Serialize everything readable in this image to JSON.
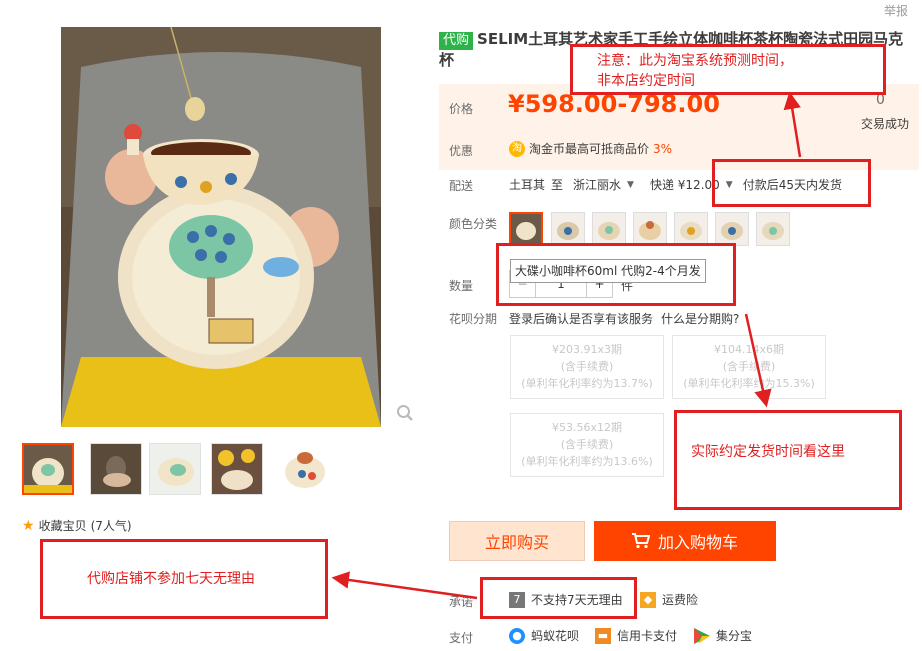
{
  "header": {
    "report_link": "举报"
  },
  "product": {
    "tag": "代购",
    "title": "SELIM土耳其艺术家手工手绘立体咖啡杯茶杯陶瓷法式田园马克杯"
  },
  "price": {
    "label": "价格",
    "value": "¥598.00-798.00",
    "sold_count": "0",
    "sold_label": "交易成功"
  },
  "promo": {
    "label": "优惠",
    "coin_icon": "淘",
    "text": "淘金币最高可抵商品价",
    "percent": "3%"
  },
  "delivery": {
    "label": "配送",
    "origin": "土耳其",
    "to_word": "至",
    "destination": "浙江丽水",
    "shipping": "快递 ¥12.00",
    "ship_time": "付款后45天内发货"
  },
  "color": {
    "label": "颜色分类",
    "tooltip": "大碟小咖啡杯60ml 代购2-4个月发",
    "option_count": 7
  },
  "quantity": {
    "label": "数量",
    "value": "1",
    "minus": "−",
    "plus": "+",
    "unit": "件"
  },
  "huabei": {
    "label": "花呗分期",
    "text": "登录后确认是否享有该服务",
    "link": "什么是分期购?",
    "stages": [
      {
        "amount": "¥203.91x3期",
        "fee": "(含手续费)",
        "rate": "(单利年化利率约为13.7%)"
      },
      {
        "amount": "¥104.14x6期",
        "fee": "(含手续费)",
        "rate": "(单利年化利率约为15.3%)"
      },
      {
        "amount": "¥53.56x12期",
        "fee": "(含手续费)",
        "rate": "(单利年化利率约为13.6%)"
      }
    ]
  },
  "actions": {
    "buy_now": "立即购买",
    "add_cart": "加入购物车"
  },
  "promise": {
    "label": "承诺",
    "no_return_icon": "7",
    "no_return": "不支持7天无理由",
    "shipping_insurance": "运费险"
  },
  "payment": {
    "label": "支付",
    "methods": [
      "蚂蚁花呗",
      "信用卡支付",
      "集分宝"
    ]
  },
  "favorite": {
    "text": "收藏宝贝",
    "count": "(7人气)"
  },
  "annotations": {
    "note_top_line1": "注意：此为淘宝系统预测时间，",
    "note_top_line2": "非本店约定时间",
    "note_right": "实际约定发货时间看这里",
    "note_left": "代购店铺不参加七天无理由"
  },
  "colors": {
    "accent": "#ff4400",
    "annotation_red": "#e02020",
    "daigou_green": "#2db34a"
  }
}
